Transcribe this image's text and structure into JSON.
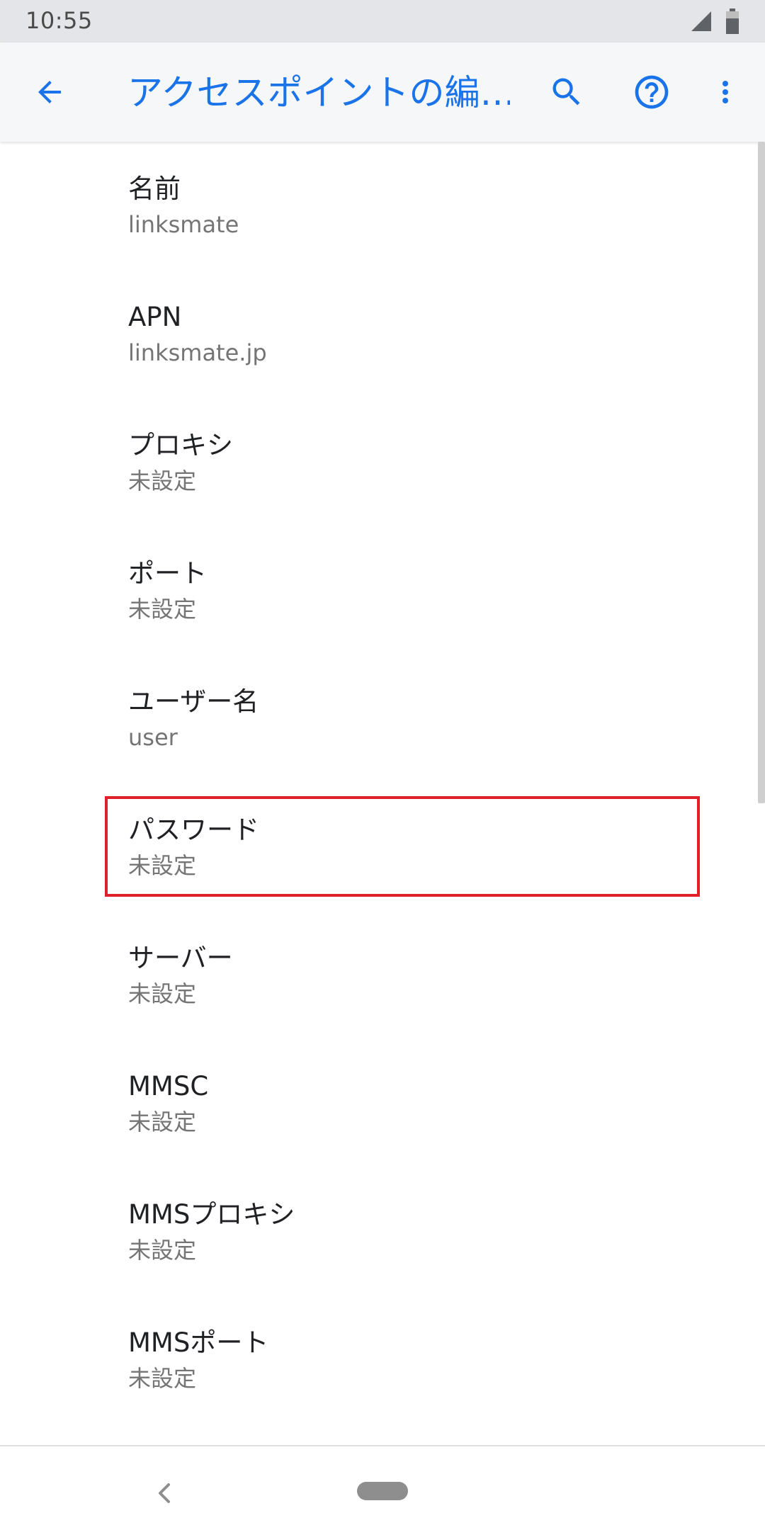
{
  "status_bar": {
    "time": "10:55",
    "icons": [
      "signal-icon",
      "battery-icon"
    ]
  },
  "app_bar": {
    "title": "アクセスポイントの編…",
    "back_icon": "arrow-left-icon",
    "search_icon": "search-icon",
    "help_icon": "help-circle-icon",
    "more_icon": "more-vertical-icon",
    "accent_color": "#1a73e8"
  },
  "settings": [
    {
      "title": "名前",
      "summary": "linksmate"
    },
    {
      "title": "APN",
      "summary": "linksmate.jp"
    },
    {
      "title": "プロキシ",
      "summary": "未設定"
    },
    {
      "title": "ポート",
      "summary": "未設定"
    },
    {
      "title": "ユーザー名",
      "summary": "user"
    },
    {
      "title": "パスワード",
      "summary": "未設定"
    },
    {
      "title": "サーバー",
      "summary": "未設定"
    },
    {
      "title": "MMSC",
      "summary": "未設定"
    },
    {
      "title": "MMSプロキシ",
      "summary": "未設定"
    },
    {
      "title": "MMSポート",
      "summary": "未設定"
    }
  ],
  "highlight": {
    "target": "パスワード",
    "color": "#e0202b"
  },
  "nav_bar": {
    "back_icon": "nav-back-icon",
    "home_icon": "home-pill-icon"
  }
}
